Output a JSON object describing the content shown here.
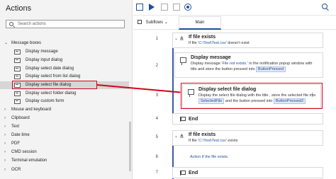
{
  "actions_panel": {
    "title": "Actions",
    "search_placeholder": "Search actions",
    "categories": [
      {
        "label": "Message boxes",
        "expanded": true,
        "items": [
          "Display message",
          "Display input dialog",
          "Display select date dialog",
          "Display select from list dialog",
          "Display select file dialog",
          "Display select folder dialog",
          "Display custom form"
        ]
      },
      {
        "label": "Mouse and keyboard"
      },
      {
        "label": "Clipboard"
      },
      {
        "label": "Text"
      },
      {
        "label": "Date time"
      },
      {
        "label": "PDF"
      },
      {
        "label": "CMD session"
      },
      {
        "label": "Terminal emulation"
      },
      {
        "label": "OCR"
      }
    ],
    "selected_item": "Display select file dialog"
  },
  "toolbar": {
    "icons": [
      "save-icon",
      "run-icon",
      "stop-icon",
      "next-step-icon",
      "record-icon",
      "find-icon"
    ]
  },
  "tabs": {
    "subflows_label": "Subflows",
    "main_label": "Main"
  },
  "flow": {
    "steps": [
      {
        "line": "1",
        "kind": "if",
        "title": "If file exists",
        "desc_prefix": "If file ",
        "desc_value": "'C:\\Test\\Test.csv'",
        "desc_suffix": " doesn't exist"
      },
      {
        "line": "2",
        "kind": "action",
        "title": "Display message",
        "desc_1": "Display message ",
        "desc_link": "'File not exists.'",
        "desc_2": " in the notification popup window with title  and store the button pressed into",
        "desc_var": "ButtonPressed"
      },
      {
        "line": "3",
        "kind": "action",
        "title": "Display select file dialog",
        "desc_1": "Display the select file dialog with the title , store the selected file into ",
        "desc_var1": "SelectedFile",
        "desc_2": " and the button pressed into",
        "desc_var2": "ButtonPressed2"
      },
      {
        "line": "4",
        "kind": "end",
        "title": "End"
      },
      {
        "line": "5",
        "kind": "if",
        "title": "If file exists",
        "desc_prefix": "If file ",
        "desc_value": "'C:\\Test\\Test.csv'",
        "desc_suffix": " exists"
      },
      {
        "line": "6",
        "kind": "action",
        "title": "",
        "desc_link_only": "Action if the file exists."
      },
      {
        "line": "7",
        "kind": "end",
        "title": "End"
      }
    ]
  },
  "colors": {
    "accent": "#1f4e9e",
    "highlight": "#d9001b"
  }
}
